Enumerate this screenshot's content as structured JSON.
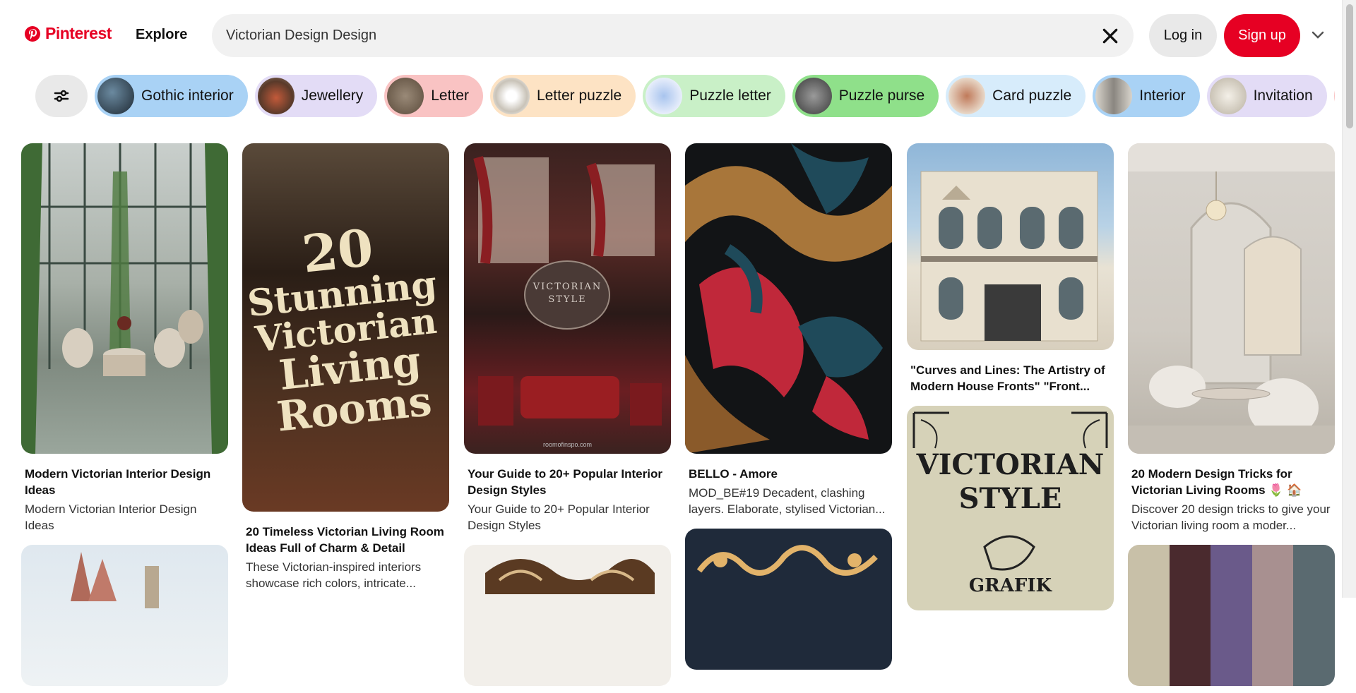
{
  "header": {
    "logo_text": "Pinterest",
    "explore_label": "Explore",
    "search_value": "Victorian Design Design",
    "login_label": "Log in",
    "signup_label": "Sign up"
  },
  "colors": {
    "brand": "#e60023"
  },
  "chips": [
    {
      "label": "Gothic interior",
      "bg": "#a9d2f5"
    },
    {
      "label": "Jewellery",
      "bg": "#e3dcf6"
    },
    {
      "label": "Letter",
      "bg": "#f9c3c3"
    },
    {
      "label": "Letter puzzle",
      "bg": "#fde3c4"
    },
    {
      "label": "Puzzle letter",
      "bg": "#c9f0c7"
    },
    {
      "label": "Puzzle purse",
      "bg": "#8fe08a"
    },
    {
      "label": "Card puzzle",
      "bg": "#d7ecfb"
    },
    {
      "label": "Interior",
      "bg": "#a9d2f5"
    },
    {
      "label": "Invitation",
      "bg": "#e3dcf6"
    }
  ],
  "pins": {
    "c1p1": {
      "title": "Modern Victorian Interior Design Ideas",
      "desc": "Modern Victorian Interior Design Ideas"
    },
    "c2p1": {
      "title": "20 Timeless Victorian Living Room Ideas Full of Charm & Detail",
      "desc": "These Victorian-inspired interiors showcase rich colors, intricate...",
      "img_text": [
        "20",
        "Stunning",
        "Victorian",
        "Living",
        "Rooms"
      ]
    },
    "c3p1": {
      "title": "Your Guide to 20+ Popular Interior Design Styles",
      "desc": "Your Guide to 20+ Popular Interior Design Styles",
      "img_text": [
        "VICTORIAN",
        "STYLE"
      ],
      "img_credit": "roomofinspo.com"
    },
    "c4p1": {
      "title": "BELLO - Amore",
      "desc": "MOD_BE#19 Decadent, clashing layers. Elaborate, stylised Victorian..."
    },
    "c5p1": {
      "title": "\"Curves and Lines: The Artistry of Modern House Fronts\" \"Front..."
    },
    "c5p2": {
      "img_text": [
        "VICTORIAN",
        "STYLE",
        "GRAFIK"
      ]
    },
    "c6p1": {
      "title": "20 Modern Design Tricks for Victorian Living Rooms 🌷 🏠",
      "desc": "Discover 20 design tricks to give your Victorian living room a moder..."
    }
  }
}
